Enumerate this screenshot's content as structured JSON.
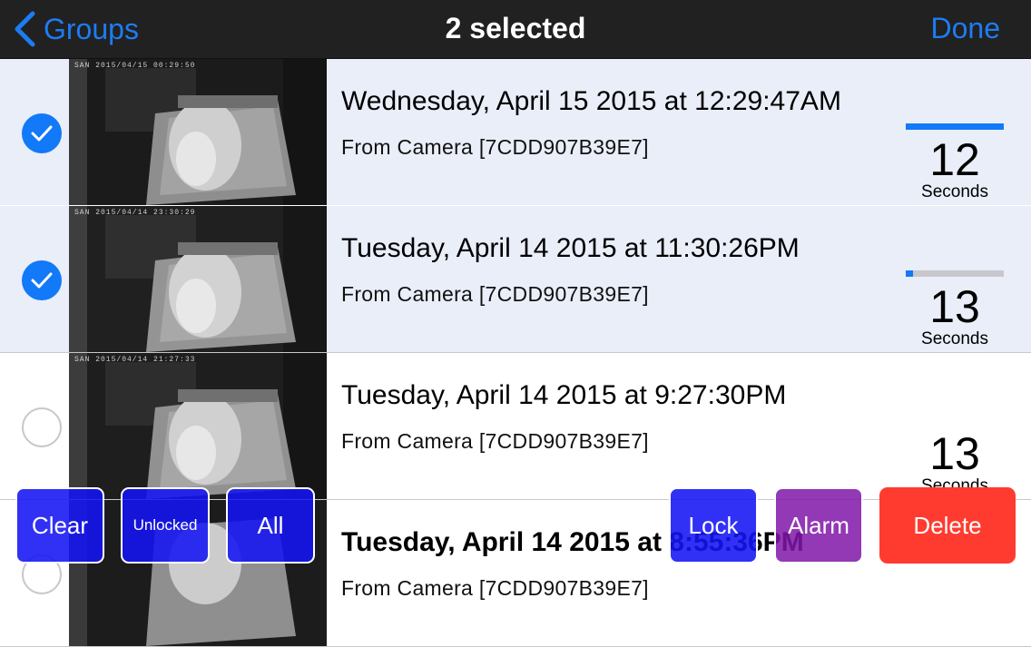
{
  "nav": {
    "back_label": "Groups",
    "title": "2 selected",
    "done_label": "Done"
  },
  "rows": [
    {
      "title": "Wednesday, April 15 2015 at 12:29:47AM",
      "subtitle": "From Camera [7CDD907B39E7]",
      "stamp": "SAN 2015/04/15 00:29:50",
      "duration": "12",
      "unit": "Seconds",
      "selected": true,
      "progress": 1.0
    },
    {
      "title": "Tuesday, April 14 2015 at 11:30:26PM",
      "subtitle": "From Camera [7CDD907B39E7]",
      "stamp": "SAN 2015/04/14 23:30:29",
      "duration": "13",
      "unit": "Seconds",
      "selected": true,
      "progress": 0.07
    },
    {
      "title": "Tuesday, April 14 2015 at 9:27:30PM",
      "subtitle": "From Camera [7CDD907B39E7]",
      "stamp": "SAN 2015/04/14 21:27:33",
      "duration": "13",
      "unit": "Seconds",
      "selected": false
    },
    {
      "title": "Tuesday, April 14 2015 at 8:55:36PM",
      "subtitle": "From Camera [7CDD907B39E7]",
      "stamp": "",
      "duration": "",
      "unit": "",
      "selected": false
    }
  ],
  "toolbar": {
    "clear_label": "Clear",
    "unlocked_label": "Unlocked",
    "all_label": "All",
    "lock_label": "Lock",
    "alarm_label": "Alarm",
    "delete_label": "Delete"
  },
  "colors": {
    "accent": "#1d7cf2",
    "selected_row": "#e9eef8",
    "nav_bg": "#212121",
    "toolbar_blue": "#1414f5",
    "toolbar_purple": "#8016a8",
    "delete_red": "#ff3b30"
  },
  "icons": {
    "back": "chevron-left-icon",
    "check": "checkmark-icon"
  }
}
